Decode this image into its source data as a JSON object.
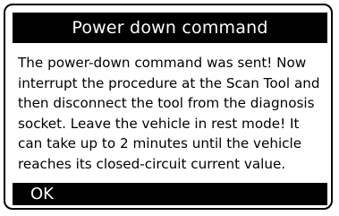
{
  "dialog": {
    "title": "Power down command",
    "message": "The power-down command was sent! Now interrupt the procedure at the Scan Tool and then disconnect the tool from the diagnosis socket. Leave the vehicle in rest mode! It can take up to 2 minutes until the vehicle reaches its closed-circuit current value.",
    "ok_label": "OK"
  },
  "colors": {
    "bar_background": "#000000",
    "bar_text": "#ffffff",
    "screen_background": "#ffffff",
    "text": "#000000"
  }
}
